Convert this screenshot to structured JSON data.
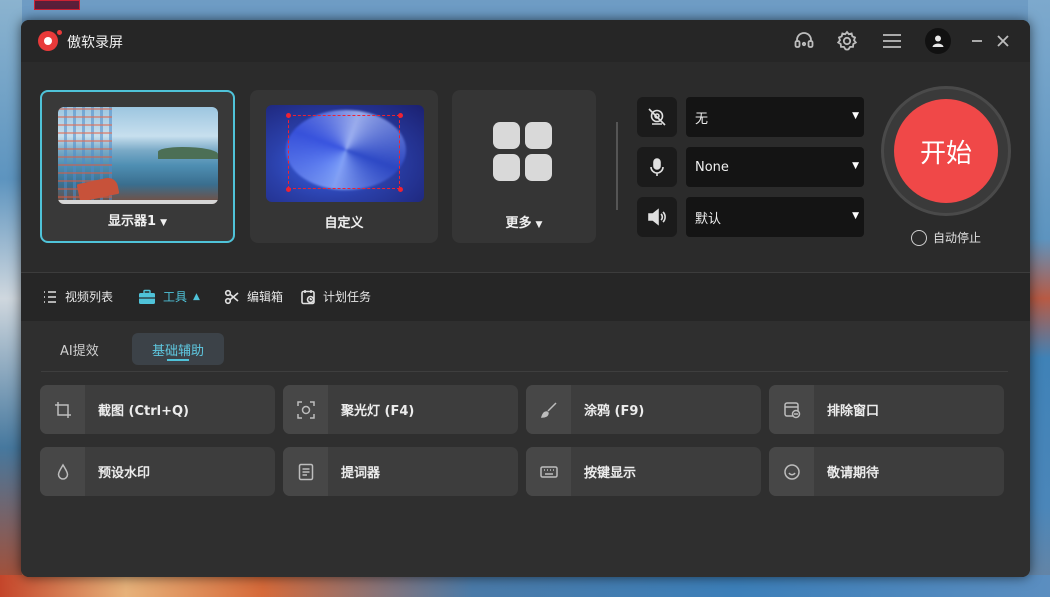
{
  "app": {
    "title": "傲软录屏"
  },
  "sources": [
    {
      "label": "显示器1",
      "has_caret": true
    },
    {
      "label": "自定义",
      "has_caret": false
    },
    {
      "label": "更多",
      "has_caret": true
    }
  ],
  "devices": {
    "camera": {
      "icon": "camera-off-icon",
      "value": "无"
    },
    "microphone": {
      "icon": "microphone-icon",
      "value": "None"
    },
    "speaker": {
      "icon": "speaker-icon",
      "value": "默认"
    }
  },
  "start": {
    "label": "开始",
    "color": "#f04848"
  },
  "autostop": {
    "label": "自动停止",
    "checked": false
  },
  "nav": {
    "video_list": "视频列表",
    "tools": "工具",
    "editor": "编辑箱",
    "schedule": "计划任务"
  },
  "subtabs": {
    "ai": "AI提效",
    "basic": "基础辅助"
  },
  "tools": [
    {
      "label": "截图 (Ctrl+Q)",
      "icon": "crop-icon"
    },
    {
      "label": "聚光灯 (F4)",
      "icon": "spotlight-icon"
    },
    {
      "label": "涂鸦 (F9)",
      "icon": "brush-icon"
    },
    {
      "label": "排除窗口",
      "icon": "exclude-window-icon"
    },
    {
      "label": "预设水印",
      "icon": "watermark-drop-icon"
    },
    {
      "label": "提词器",
      "icon": "teleprompter-icon"
    },
    {
      "label": "按键显示",
      "icon": "keyboard-icon"
    },
    {
      "label": "敬请期待",
      "icon": "smile-icon"
    }
  ],
  "colors": {
    "accent": "#4fc3d9",
    "window_bg": "#2b2b2b"
  }
}
